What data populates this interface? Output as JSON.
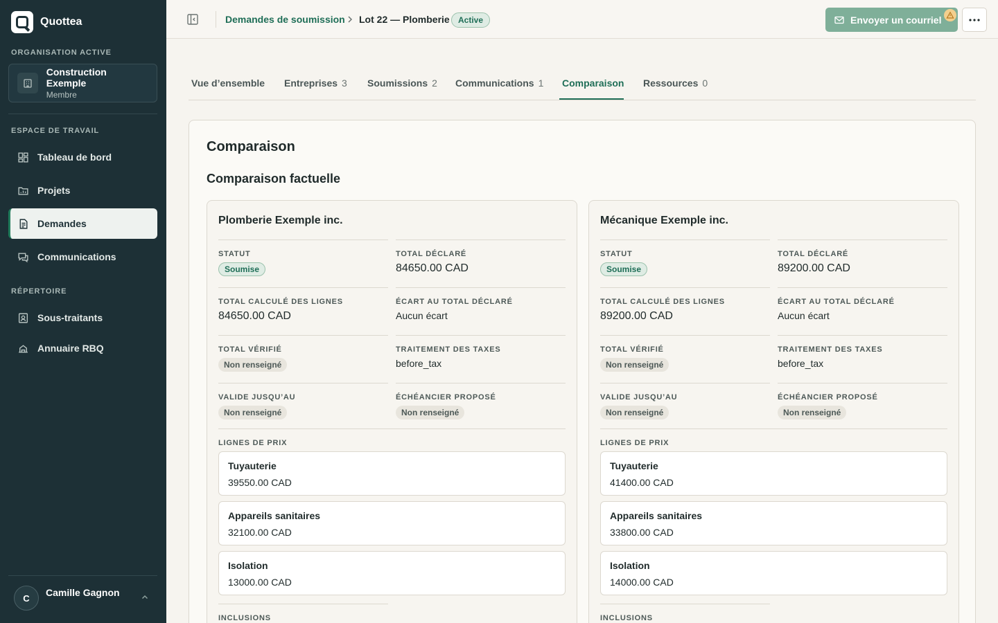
{
  "brand": {
    "name": "Quottea"
  },
  "sidebar": {
    "org_section": "Organisation active",
    "org": {
      "name": "Construction Exemple",
      "role": "Membre"
    },
    "workspace_section": "Espace de travail",
    "workspace_items": [
      {
        "label": "Tableau de bord",
        "icon": "dashboard-icon"
      },
      {
        "label": "Projets",
        "icon": "folder-icon"
      },
      {
        "label": "Demandes",
        "icon": "document-icon",
        "active": true
      },
      {
        "label": "Communications",
        "icon": "chat-icon"
      }
    ],
    "directory_section": "Répertoire",
    "directory_items": [
      {
        "label": "Sous-traitants",
        "icon": "contact-icon"
      },
      {
        "label": "Annuaire RBQ",
        "icon": "building-icon"
      }
    ],
    "user": {
      "initial": "C",
      "name": "Camille Gagnon"
    }
  },
  "topbar": {
    "breadcrumb_link": "Demandes de soumission",
    "breadcrumb_current": "Lot 22 — Plomberie",
    "status_badge": "Active",
    "email_button": "Envoyer un courriel"
  },
  "tabs": [
    {
      "label": "Vue d’ensemble",
      "count": ""
    },
    {
      "label": "Entreprises",
      "count": "3"
    },
    {
      "label": "Soumissions",
      "count": "2"
    },
    {
      "label": "Communications",
      "count": "1"
    },
    {
      "label": "Comparaison",
      "count": "",
      "active": true
    },
    {
      "label": "Ressources",
      "count": "0"
    }
  ],
  "comparison": {
    "title": "Comparaison",
    "subtitle": "Comparaison factuelle",
    "labels": {
      "status": "Statut",
      "declared_total": "Total déclaré",
      "computed_total": "Total calculé des lignes",
      "gap": "Écart au total déclaré",
      "verified_total": "Total vérifié",
      "tax_treatment": "Traitement des taxes",
      "valid_until": "Valide jusqu’au",
      "schedule": "Échéancier proposé",
      "price_lines": "Lignes de prix",
      "inclusions": "Inclusions"
    },
    "companies": [
      {
        "name": "Plomberie Exemple inc.",
        "status": "Soumise",
        "declared_total": "84650.00 CAD",
        "computed_total": "84650.00 CAD",
        "gap": "Aucun écart",
        "verified_total": "Non renseigné",
        "tax_treatment": "before_tax",
        "valid_until": "Non renseigné",
        "schedule": "Non renseigné",
        "lines": [
          {
            "name": "Tuyauterie",
            "amount": "39550.00 CAD"
          },
          {
            "name": "Appareils sanitaires",
            "amount": "32100.00 CAD"
          },
          {
            "name": "Isolation",
            "amount": "13000.00 CAD"
          }
        ]
      },
      {
        "name": "Mécanique Exemple inc.",
        "status": "Soumise",
        "declared_total": "89200.00 CAD",
        "computed_total": "89200.00 CAD",
        "gap": "Aucun écart",
        "verified_total": "Non renseigné",
        "tax_treatment": "before_tax",
        "valid_until": "Non renseigné",
        "schedule": "Non renseigné",
        "lines": [
          {
            "name": "Tuyauterie",
            "amount": "41400.00 CAD"
          },
          {
            "name": "Appareils sanitaires",
            "amount": "33800.00 CAD"
          },
          {
            "name": "Isolation",
            "amount": "14000.00 CAD"
          }
        ]
      }
    ]
  },
  "colors": {
    "sidebar_bg": "#1d3036",
    "accent": "#1f6e57",
    "email_button": "#7faf99",
    "warning": "#f3cf8e"
  }
}
